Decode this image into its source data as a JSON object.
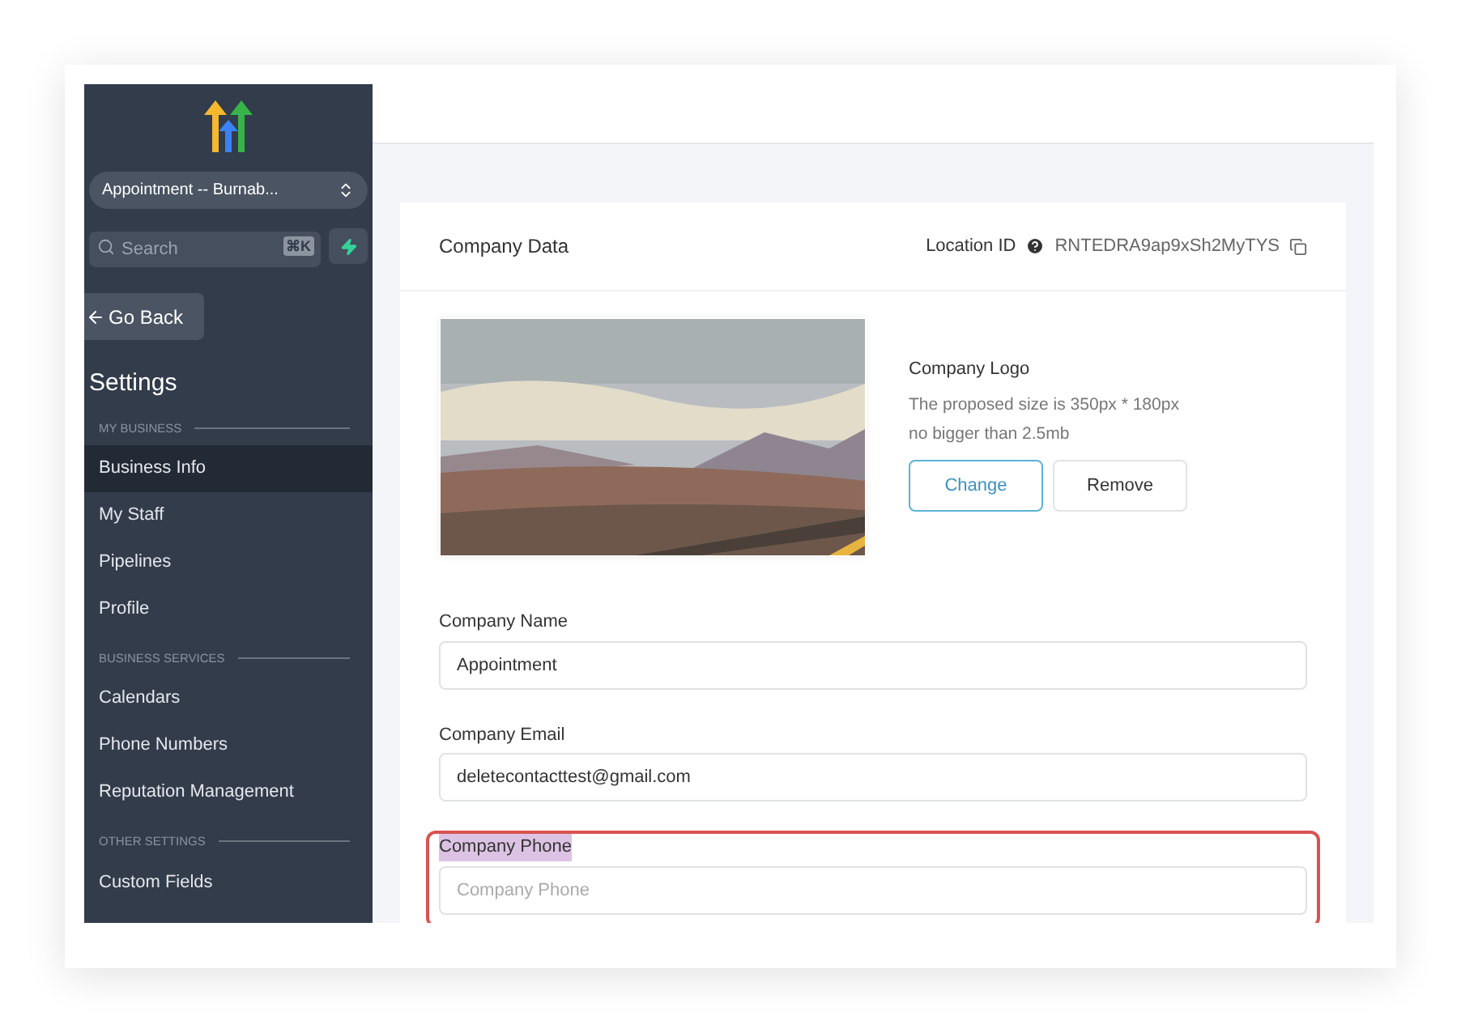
{
  "sidebar": {
    "account_switcher": {
      "label": "Appointment -- Burnab..."
    },
    "search": {
      "placeholder": "Search",
      "shortcut": "⌘K"
    },
    "back_button": {
      "label": "Go Back"
    },
    "title": "Settings",
    "sections": [
      {
        "heading": "MY BUSINESS",
        "items": [
          {
            "label": "Business Info",
            "selected": true
          },
          {
            "label": "My Staff",
            "selected": false
          },
          {
            "label": "Pipelines",
            "selected": false
          },
          {
            "label": "Profile",
            "selected": false
          }
        ]
      },
      {
        "heading": "BUSINESS SERVICES",
        "items": [
          {
            "label": "Calendars",
            "selected": false
          },
          {
            "label": "Phone Numbers",
            "selected": false
          },
          {
            "label": "Reputation Management",
            "selected": false
          }
        ]
      },
      {
        "heading": "OTHER SETTINGS",
        "items": [
          {
            "label": "Custom Fields",
            "selected": false
          }
        ]
      }
    ]
  },
  "card": {
    "title": "Company Data",
    "location_label": "Location ID",
    "location_id": "RNTEDRA9ap9xSh2MyTYS",
    "logo": {
      "kind": "picture",
      "title": "Company Logo",
      "hint_lines": [
        "The proposed size is 350px * 180px",
        "no bigger than 2.5mb"
      ],
      "buttons": [
        {
          "label": "Change",
          "primary": true
        },
        {
          "label": "Remove",
          "primary": false
        }
      ]
    },
    "fields": [
      {
        "label": "Company Name",
        "value": "Appointment",
        "highlighted": false,
        "outlined": false
      },
      {
        "label": "Company Email",
        "value": "deletecontacttest@gmail.com",
        "highlighted": false,
        "outlined": false
      },
      {
        "label": "Company Phone",
        "placeholder": "Company Phone",
        "highlighted": true,
        "outlined": true
      }
    ]
  }
}
